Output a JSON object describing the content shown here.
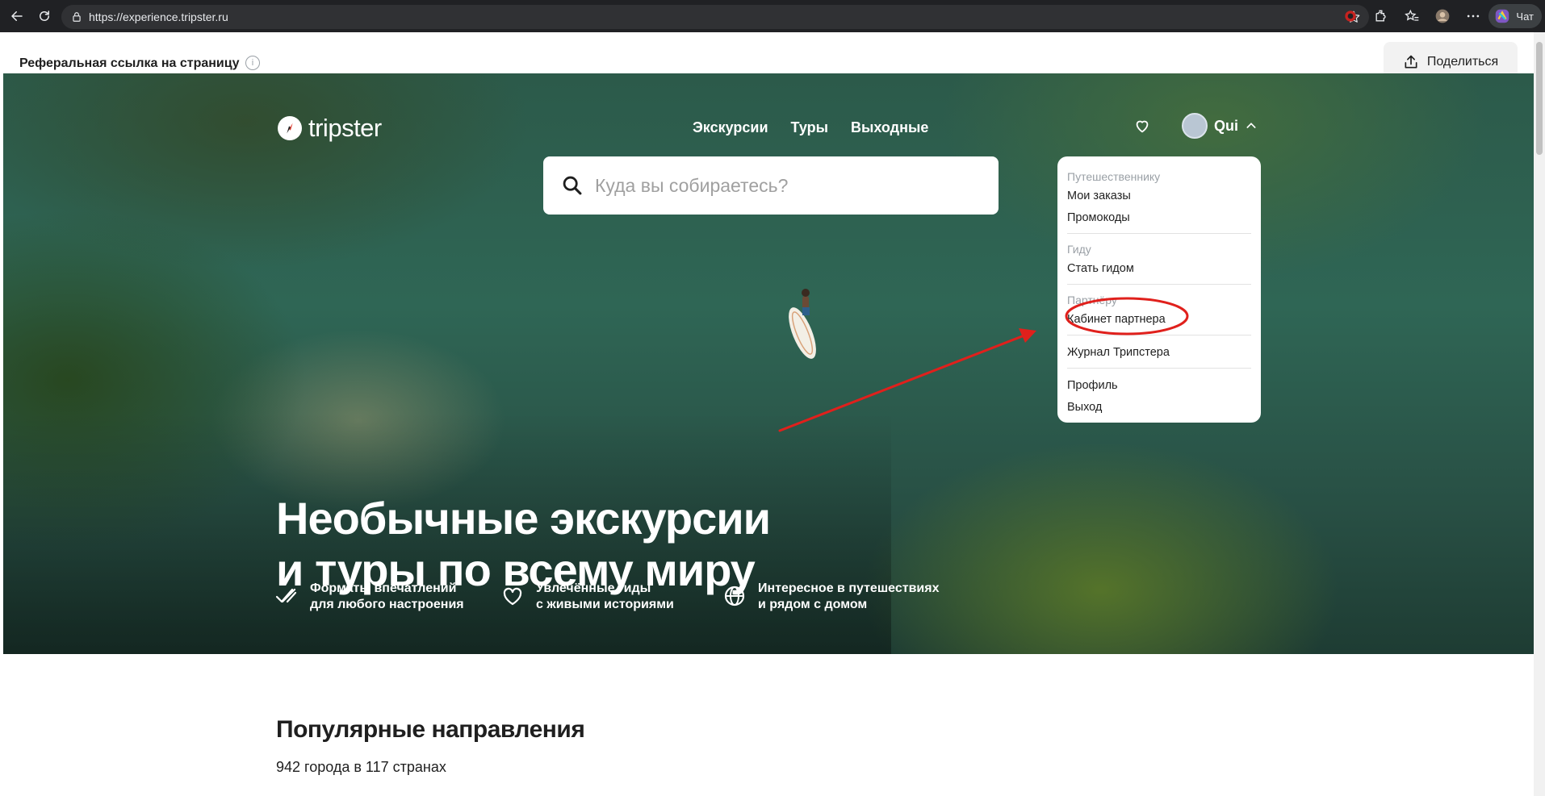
{
  "browser": {
    "url": "https://experience.tripster.ru",
    "chat_label": "Чат"
  },
  "referral": {
    "label": "Реферальная ссылка на страницу",
    "info_glyph": "i",
    "share_label": "Поделиться"
  },
  "header": {
    "logo_text": "tripster",
    "nav": [
      "Экскурсии",
      "Туры",
      "Выходные"
    ],
    "user_name": "Qui"
  },
  "search": {
    "placeholder": "Куда вы собираетесь?"
  },
  "dropdown": {
    "traveler_heading": "Путешественнику",
    "my_orders": "Мои заказы",
    "promocodes": "Промокоды",
    "guide_heading": "Гиду",
    "become_guide": "Стать гидом",
    "partner_heading": "Партнёру",
    "partner_cabinet": "Кабинет партнера",
    "journal": "Журнал Трипстера",
    "profile": "Профиль",
    "logout": "Выход"
  },
  "hero": {
    "title_line1": "Необычные экскурсии",
    "title_line2": "и туры по всему миру",
    "features": [
      {
        "line1": "Форматы впечатлений",
        "line2": "для любого настроения",
        "icon": "double-check-icon"
      },
      {
        "line1": "Увлечённые гиды",
        "line2": "с живыми историями",
        "icon": "heart-icon"
      },
      {
        "line1": "Интересное в путешествиях",
        "line2": "и рядом с домом",
        "icon": "globe-icon"
      }
    ]
  },
  "popular": {
    "title": "Популярные направления",
    "subtitle": "942 города в 117 странах"
  },
  "colors": {
    "annotation": "#e0201c",
    "chrome_bg": "#202124"
  }
}
